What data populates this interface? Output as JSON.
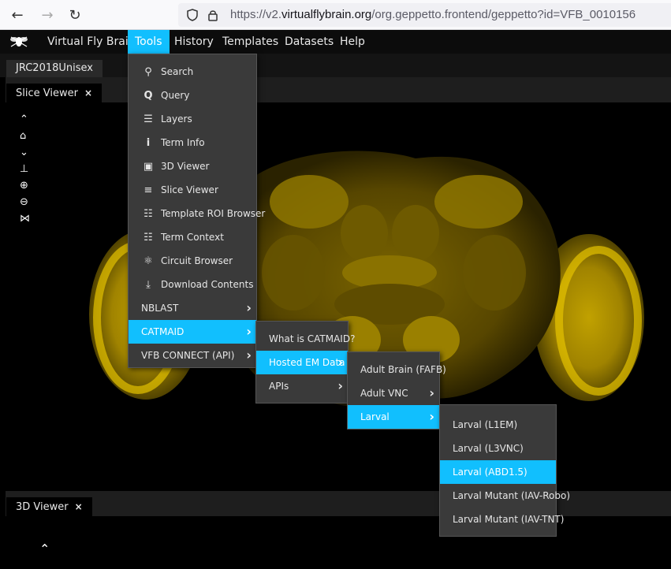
{
  "browser": {
    "url_prefix": "https://v2.",
    "url_domain": "virtualflybrain.org",
    "url_suffix": "/org.geppetto.frontend/geppetto?id=VFB_0010156"
  },
  "app": {
    "title": "Virtual Fly Brain",
    "nav": [
      "Tools",
      "History",
      "Templates",
      "Datasets",
      "Help"
    ]
  },
  "template_tab": "JRC2018Unisex",
  "slice_viewer": {
    "title": "Slice Viewer",
    "close": "×"
  },
  "viewer3d": {
    "title": "3D Viewer",
    "close": "×"
  },
  "tools_menu": [
    {
      "label": "Search",
      "icon": "search-icon"
    },
    {
      "label": "Query",
      "icon": "query-icon"
    },
    {
      "label": "Layers",
      "icon": "list-icon"
    },
    {
      "label": "Term Info",
      "icon": "info-icon"
    },
    {
      "label": "3D Viewer",
      "icon": "cube-icon"
    },
    {
      "label": "Slice Viewer",
      "icon": "sliders-icon"
    },
    {
      "label": "Template ROI Browser",
      "icon": "tree-list-icon"
    },
    {
      "label": "Term Context",
      "icon": "hierarchy-icon"
    },
    {
      "label": "Circuit Browser",
      "icon": "circuit-icon"
    },
    {
      "label": "Download Contents",
      "icon": "download-icon"
    },
    {
      "label": "NBLAST"
    },
    {
      "label": "CATMAID"
    },
    {
      "label": "VFB CONNECT (API)"
    }
  ],
  "catmaid_menu": [
    "What is CATMAID?",
    "Hosted EM Data",
    "APIs"
  ],
  "hosted_menu": [
    "Adult Brain (FAFB)",
    "Adult VNC",
    "Larval"
  ],
  "larval_menu": [
    "Larval (L1EM)",
    "Larval (L3VNC)",
    "Larval (ABD1.5)",
    "Larval Mutant (IAV-Robo)",
    "Larval Mutant (IAV-TNT)"
  ],
  "colors": {
    "accent": "#11bffe",
    "brain": "#c8a800"
  }
}
